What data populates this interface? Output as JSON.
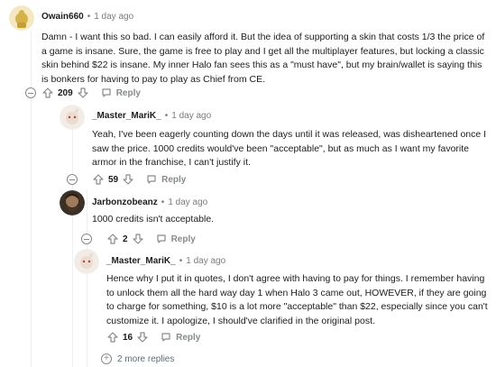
{
  "comments": [
    {
      "username": "Owain660",
      "time": "1 day ago",
      "body": "Damn - I want this so bad. I can easily afford it. But the idea of supporting a skin that costs 1/3 the price of a game is insane. Sure, the game is free to play and I get all the multiplayer features, but locking a classic skin behind $22 is insane. My inner Halo fan sees this as a \"must have\", but my brain/wallet is saying this is bonkers for having to pay to play as Chief from CE.",
      "score": "209",
      "reply_label": "Reply"
    },
    {
      "username": "_Master_MariK_",
      "time": "1 day ago",
      "body": "Yeah, I've been eagerly counting down the days until it was released, was disheartened once I saw the price. 1000 credits would've been \"acceptable\", but as much as I want my favorite armor in the franchise, I can't justify it.",
      "score": "59",
      "reply_label": "Reply"
    },
    {
      "username": "Jarbonzobeanz",
      "time": "1 day ago",
      "body": "1000 credits isn't acceptable.",
      "score": "2",
      "reply_label": "Reply"
    },
    {
      "username": "_Master_MariK_",
      "time": "1 day ago",
      "body": "Hence why I put it in quotes, I don't agree with having to pay for things. I remember having to unlock them all the hard way day 1 when Halo 3 came out, HOWEVER, if they are going to charge for something, $10 is a lot more \"acceptable\" than $22, especially since you can't customize it. I apologize, I should've clarified in the original post.",
      "score": "16",
      "reply_label": "Reply"
    }
  ],
  "more_replies_label": "2 more replies",
  "separator": "•",
  "colors": {
    "owain_avatar": "#d4b24a",
    "marik_avatar": "#e8dcd3",
    "jarbonzo_avatar": "#6b5a4a"
  }
}
